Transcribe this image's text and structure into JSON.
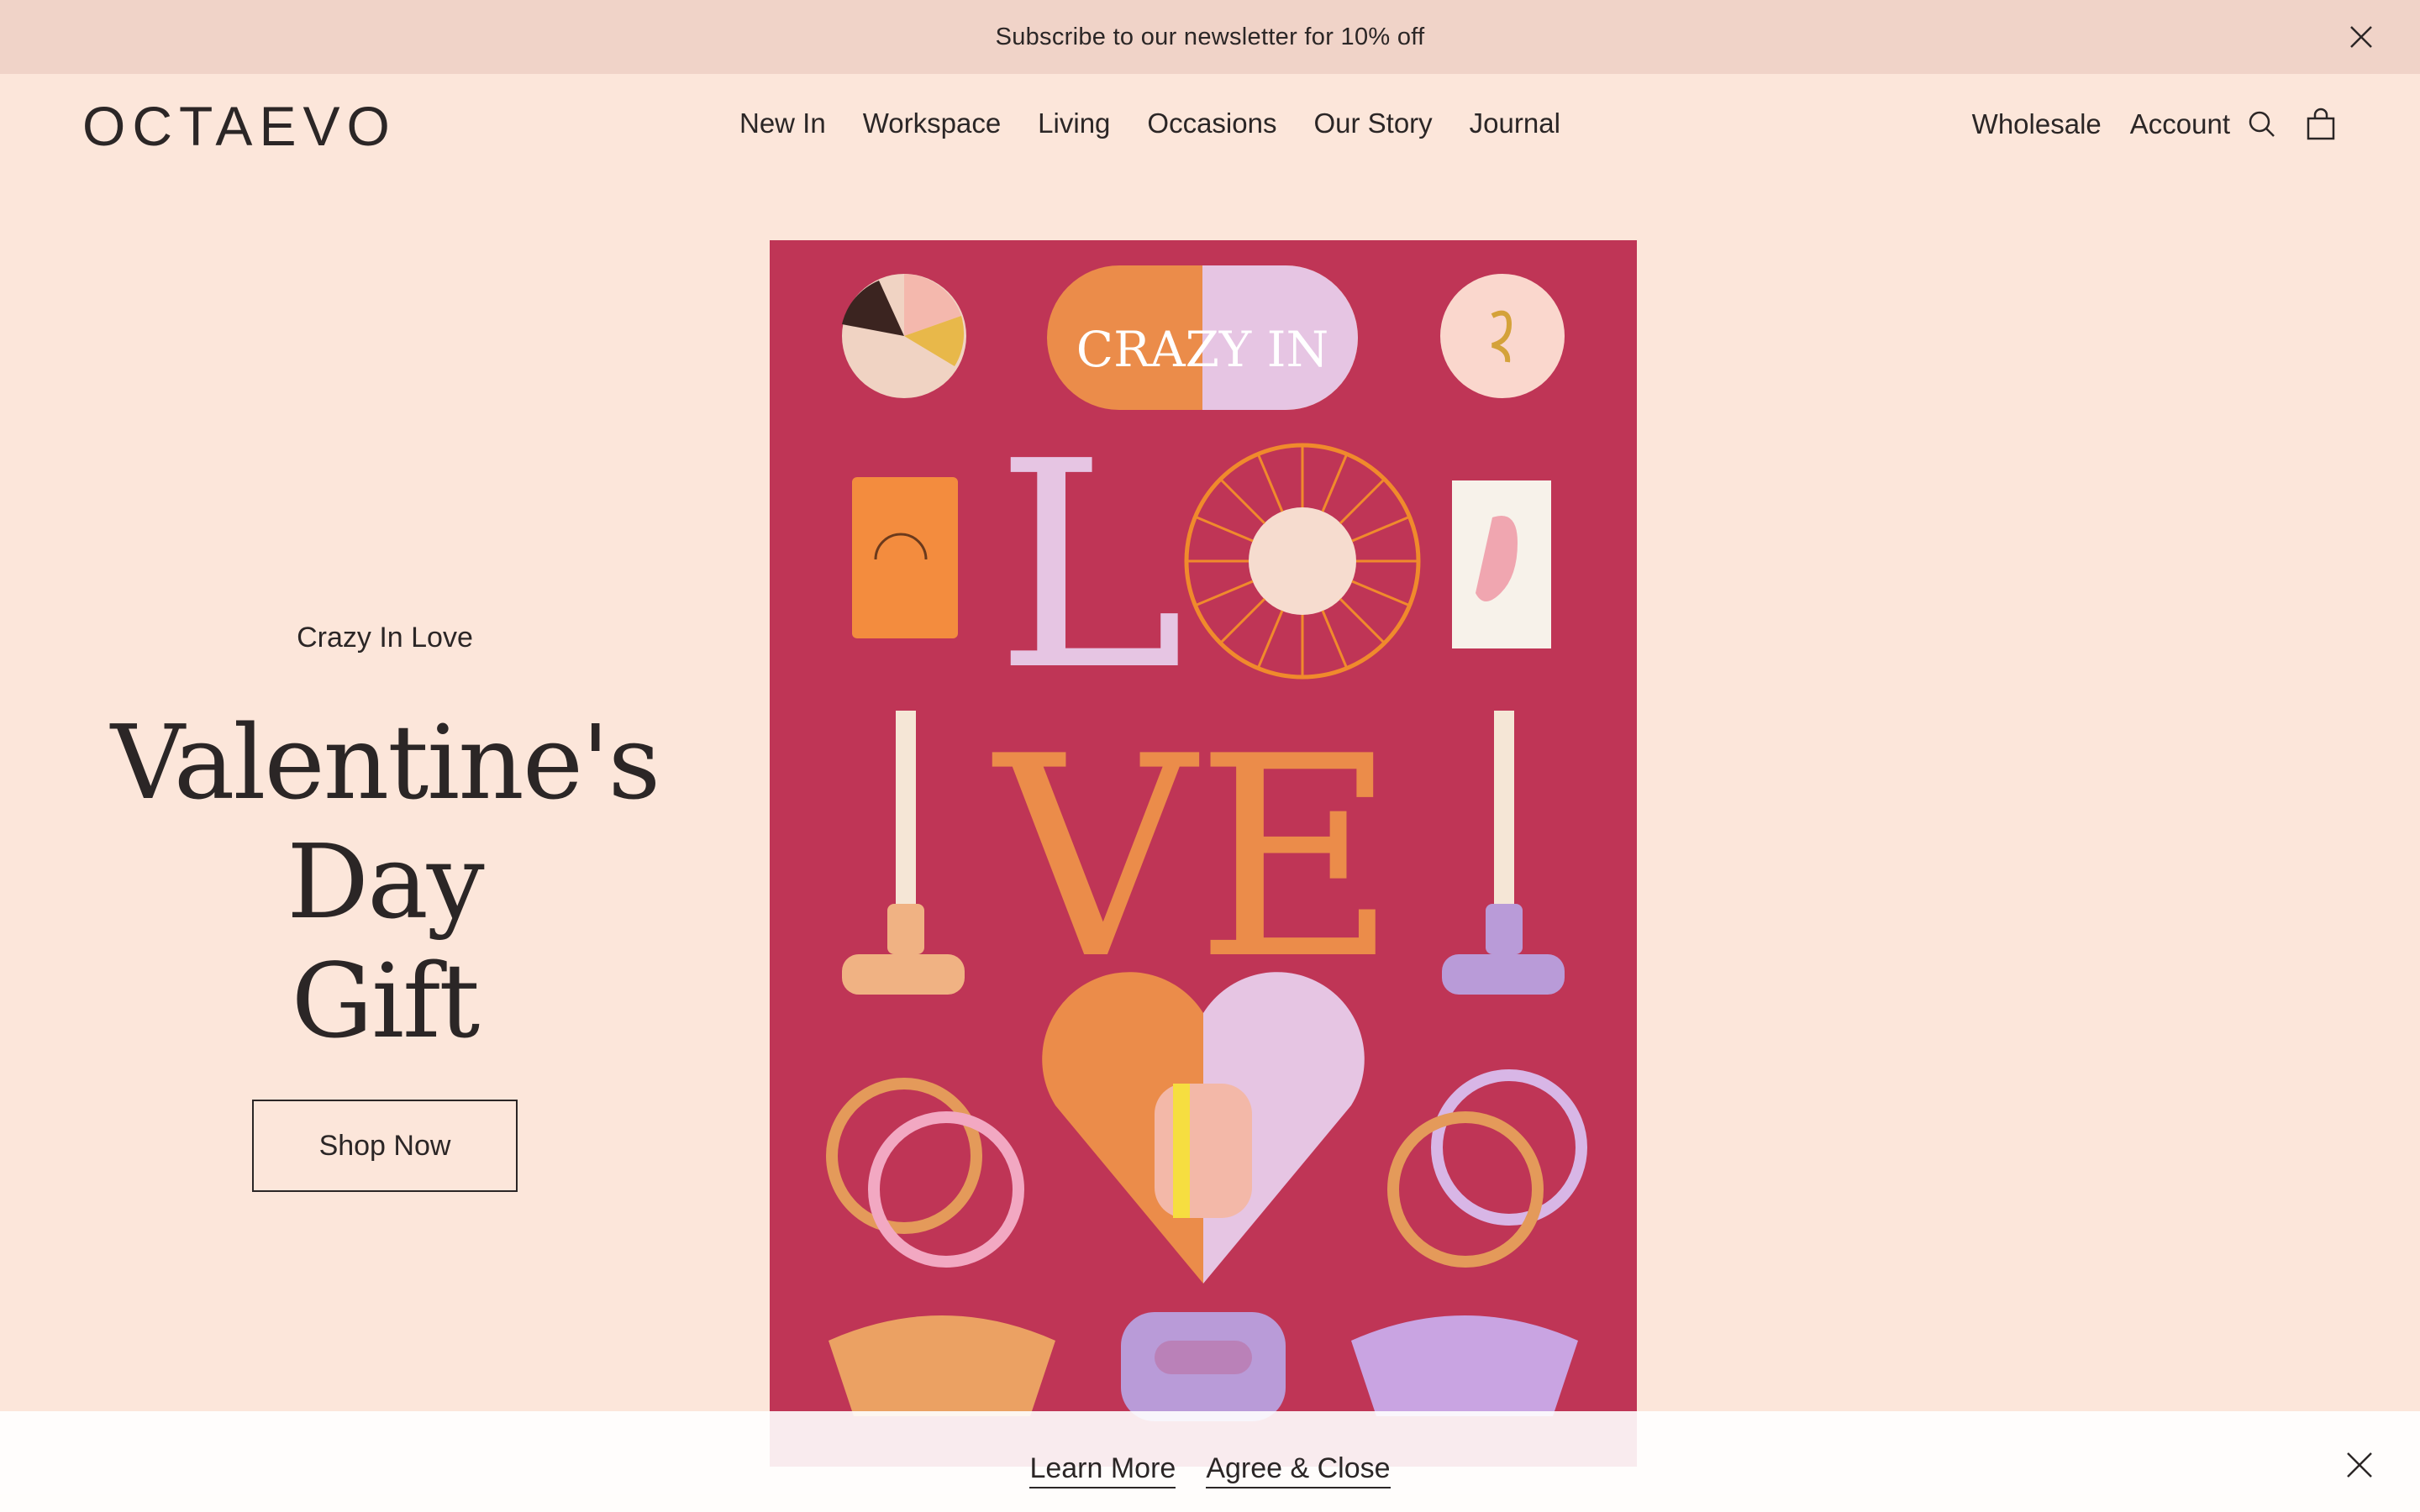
{
  "announcement": {
    "text": "Subscribe to our newsletter for 10% off"
  },
  "header": {
    "logo": "OCTAEVO",
    "nav": [
      "New In",
      "Workspace",
      "Living",
      "Occasions",
      "Our Story",
      "Journal"
    ],
    "wholesale": "Wholesale",
    "account": "Account",
    "icons": {
      "search": "search-icon",
      "cart": "shopping-bag-icon",
      "close": "close-icon"
    }
  },
  "hero": {
    "eyebrow": "Crazy In Love",
    "headline_line1": "Valentine's Day",
    "headline_line2": "Gift",
    "button": "Shop Now",
    "poster": {
      "top_text": "CRAZY IN",
      "big_word_1": "L",
      "big_word_2": "VE"
    }
  },
  "cookie_bar": {
    "learn_more": "Learn More",
    "agree": "Agree & Close"
  },
  "colors": {
    "page_bg": "#fce6da",
    "announce_bg": "#f0d3c8",
    "poster_bg": "#bf3556",
    "orange": "#eb8c4a",
    "lilac": "#e6c5e3",
    "pink": "#eeb8c4",
    "text": "#2b2626"
  }
}
